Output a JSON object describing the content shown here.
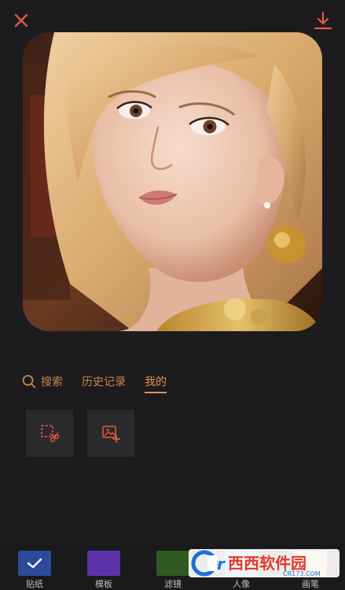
{
  "header": {
    "close_icon": "close-icon",
    "download_icon": "download-icon",
    "accent_color": "#e15a3f"
  },
  "tabs": [
    {
      "label": "搜索",
      "icon": "search-icon",
      "active": false
    },
    {
      "label": "历史记录",
      "active": false
    },
    {
      "label": "我的",
      "active": true
    }
  ],
  "tiles": [
    {
      "icon": "crop-cutout-icon"
    },
    {
      "icon": "add-image-icon"
    }
  ],
  "toolbar": {
    "items": [
      {
        "label": "贴纸",
        "color": "#2d4a9a",
        "selected": true
      },
      {
        "label": "模板",
        "color": "#5b33a8",
        "selected": false
      },
      {
        "label": "滤镜",
        "color": "#2f5a22",
        "selected": false
      },
      {
        "label": "人像",
        "color": "#2f8fd8",
        "selected": false
      },
      {
        "label": "画笔",
        "color": "#e0a85a",
        "selected": false
      }
    ]
  },
  "watermark": {
    "brand": "西西软件园",
    "url": "CR173.COM"
  }
}
